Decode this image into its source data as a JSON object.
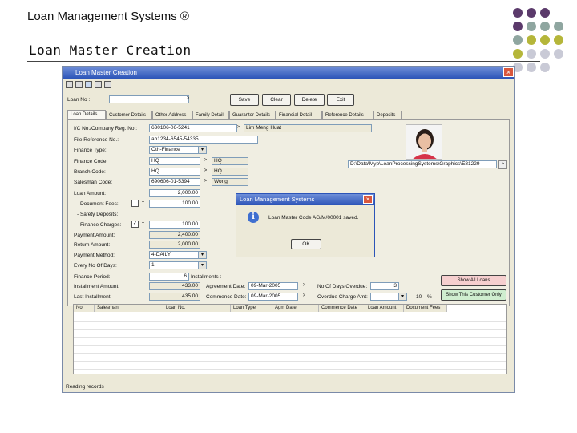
{
  "slide": {
    "title": "Loan Management Systems ®",
    "subtitle": "Loan Master Creation",
    "dot_colors": [
      "#5b3a6b",
      "#8fa6a0",
      "#b5b63a",
      "#c9cad6"
    ]
  },
  "window": {
    "title": "Loan Master Creation",
    "close_glyph": "×",
    "loan_no_label": "Loan No :",
    "loan_no_value": "",
    "buttons": {
      "save": "Save",
      "clear": "Clear",
      "delete": "Delete",
      "exit": "Exit"
    },
    "tabs": [
      "Loan Details",
      "Customer Details",
      "Other Address",
      "Family Detail",
      "Guarantor Details",
      "Financial Detail",
      "Reference Details",
      "Deposits"
    ],
    "fields": {
      "ic_label": "I/C No./Company Reg. No.:",
      "ic_value": "630106-06-5241",
      "customer_name": "Lim Meng Huat",
      "file_ref_label": "File Reference No.:",
      "file_ref_value": "ab1234-6545-54335",
      "finance_type_label": "Finance Type:",
      "finance_type_value": "Oth-Finance",
      "finance_code_label": "Finance Code:",
      "finance_code_value": "HQ",
      "finance_code_desc": "HQ",
      "branch_code_label": "Branch Code:",
      "branch_code_value": "HQ",
      "branch_code_desc": "HQ",
      "salesman_code_label": "Salesman Code:",
      "salesman_code_value": "690606-01-5394",
      "salesman_name": "Wong",
      "loan_amount_label": "Loan Amount:",
      "loan_amount_value": "2,000.00",
      "doc_fees_label": "- Document Fees:",
      "doc_fees_value": "100.00",
      "safety_label": "- Safety Deposits:",
      "fin_charges_label": "- Finance Charges:",
      "fin_charges_value": "100.00",
      "payment_amount_label": "Payment Amount:",
      "payment_amount_value": "2,400.00",
      "return_amount_label": "Return Amount:",
      "return_amount_value": "2,000.00",
      "payment_method_label": "Payment Method:",
      "payment_method_value": "4-DAILY",
      "every_days_label": "Every No Of Days:",
      "every_days_value": "1",
      "finance_period_label": "Finance Period:",
      "finance_period_value": "6",
      "finance_period_unit": "Installments :",
      "installment_label": "Installment Amount:",
      "installment_value": "433.00",
      "last_installment_label": "Last Installment:",
      "last_installment_value": "435.00",
      "agreement_date_label": "Agreement Date:",
      "agreement_date_value": "09-Mar-2005",
      "commence_date_label": "Commence Date:",
      "commence_date_value": "09-Mar-2005",
      "days_overdue_label": "No Of Days Overdue:",
      "days_overdue_value": "3",
      "overdue_charge_label": "Overdue Charge Amt:",
      "overdue_charge_value": "10",
      "overdue_charge_unit": "%",
      "path_value": "D:\\Data\\Myp\\LoanProcessingSystems\\Graphics\\E81229",
      "show_all_loans": "Show All Loans",
      "show_this_customer": "Show This Customer Only"
    },
    "grid_headers": [
      "No.",
      "Salesman",
      "Loan No.",
      "Loan Type",
      "Agm Date",
      "Commence Date",
      "Loan Amount",
      "Document Fees"
    ],
    "status_text": "Reading records"
  },
  "dialog": {
    "title": "Loan Management Systems",
    "close_glyph": "×",
    "message": "Loan Master Code AG/M/00001 saved.",
    "ok_label": "OK"
  }
}
